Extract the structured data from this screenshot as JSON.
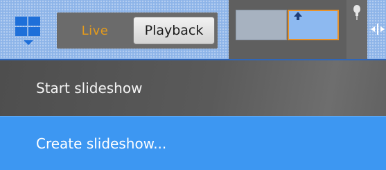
{
  "toolbar": {
    "layouts_button": {
      "icon": "grid-layout-icon",
      "dropdown_icon": "caret-down-icon",
      "icon_color": "#1e6fd9"
    },
    "mode_tabs": {
      "live_label": "Live",
      "playback_label": "Playback",
      "live_color": "#e39a1c"
    },
    "thumbnails": {
      "selected_border_color": "#e8922a"
    }
  },
  "menu": {
    "items": [
      {
        "label": "Start slideshow",
        "highlighted": false
      },
      {
        "label": "Create slideshow...",
        "highlighted": true
      }
    ],
    "highlight_color": "#3d97f2"
  }
}
